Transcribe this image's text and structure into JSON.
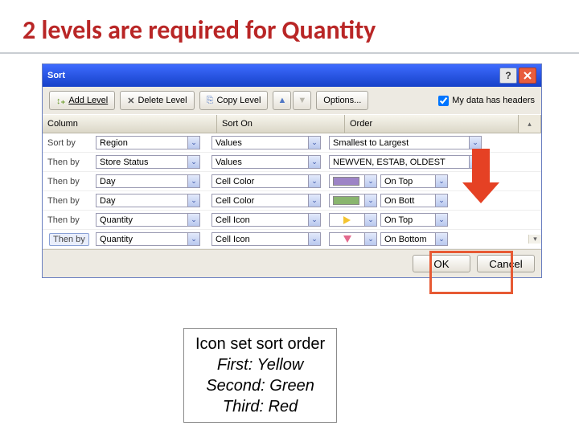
{
  "slide": {
    "title": "2 levels are required for Quantity"
  },
  "dialog": {
    "title": "Sort"
  },
  "toolbar": {
    "add_level": "Add Level",
    "delete_level": "Delete Level",
    "copy_level": "Copy Level",
    "options": "Options...",
    "headers_label": "My data has headers",
    "headers_checked": true
  },
  "headers": {
    "column": "Column",
    "sort_on": "Sort On",
    "order": "Order"
  },
  "rows": [
    {
      "label": "Sort by",
      "column": "Region",
      "sort_on": "Values",
      "order_type": "text",
      "order_text": "Smallest to Largest"
    },
    {
      "label": "Then by",
      "column": "Store Status",
      "sort_on": "Values",
      "order_type": "text",
      "order_text": "NEWVEN, ESTAB, OLDEST"
    },
    {
      "label": "Then by",
      "column": "Day",
      "sort_on": "Cell Color",
      "order_type": "color",
      "swatch": "#9D84C6",
      "pos": "On Top"
    },
    {
      "label": "Then by",
      "column": "Day",
      "sort_on": "Cell Color",
      "order_type": "color",
      "swatch": "#89B56E",
      "pos": "On Bottom",
      "pos_shown": "On Bott"
    },
    {
      "label": "Then by",
      "column": "Quantity",
      "sort_on": "Cell Icon",
      "order_type": "icon",
      "icon": "arrow-right",
      "icon_color": "#F4C430",
      "pos": "On Top"
    },
    {
      "label": "Then by",
      "column": "Quantity",
      "sort_on": "Cell Icon",
      "order_type": "icon",
      "icon": "arrow-down",
      "icon_color": "#E36A8E",
      "pos": "On Bottom",
      "selected": true
    }
  ],
  "footer": {
    "ok": "OK",
    "cancel": "Cancel"
  },
  "note": {
    "title": "Icon set sort order",
    "line1": "First: Yellow",
    "line2": "Second: Green",
    "line3": "Third: Red"
  }
}
